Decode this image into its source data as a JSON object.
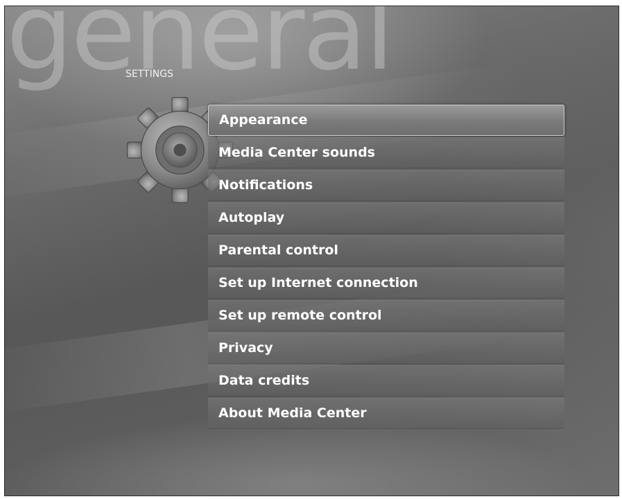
{
  "page": {
    "background_title": "general",
    "section_label": "SETTINGS"
  },
  "menu": {
    "items": [
      {
        "label": "Appearance",
        "focused": true
      },
      {
        "label": "Media Center sounds",
        "focused": false
      },
      {
        "label": "Notifications",
        "focused": false
      },
      {
        "label": "Autoplay",
        "focused": false
      },
      {
        "label": "Parental control",
        "focused": false
      },
      {
        "label": "Set up Internet connection",
        "focused": false
      },
      {
        "label": "Set up remote control",
        "focused": false
      },
      {
        "label": "Privacy",
        "focused": false
      },
      {
        "label": "Data credits",
        "focused": false
      },
      {
        "label": "About Media Center",
        "focused": false
      }
    ]
  },
  "icons": {
    "section_icon": "gear-icon"
  },
  "colors": {
    "background": "#6a6a6a",
    "item_background": "#6f6f6f",
    "focused_item_border": "#d0d0d0",
    "text": "#ffffff"
  }
}
